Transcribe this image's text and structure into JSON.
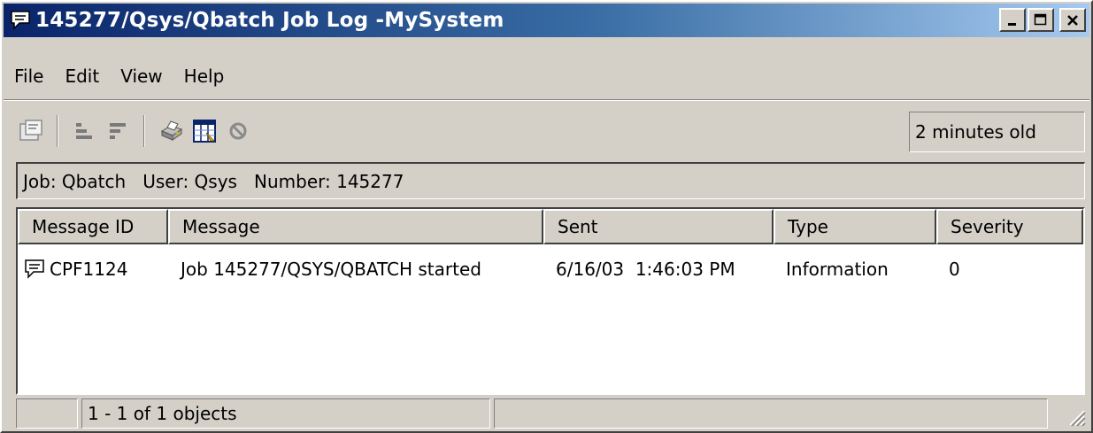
{
  "window": {
    "title": "145277/Qsys/Qbatch Job Log -MySystem",
    "title_icon": "message-bubble-icon",
    "accent_color": "#0a246a",
    "controls": [
      "minimize-icon",
      "maximize-icon",
      "close-icon"
    ]
  },
  "menu": [
    "File",
    "Edit",
    "View",
    "Help"
  ],
  "toolbar": {
    "icons": [
      "properties-icon",
      "sort-ascending-icon",
      "sort-descending-icon",
      "print-icon",
      "columns-icon",
      "stop-icon"
    ],
    "age_text": "2 minutes old"
  },
  "job_info": {
    "text": "Job: Qbatch   User: Qsys   Number: 145277"
  },
  "table": {
    "columns": [
      "Message ID",
      "Message",
      "Sent",
      "Type",
      "Severity"
    ],
    "rows": [
      {
        "icon": "message-bubble-icon",
        "message_id": "CPF1124",
        "message": "Job 145277/QSYS/QBATCH started",
        "sent": "6/16/03  1:46:03 PM",
        "type": "Information",
        "severity": "0"
      }
    ]
  },
  "status": {
    "objects": "1 - 1 of 1 objects"
  }
}
